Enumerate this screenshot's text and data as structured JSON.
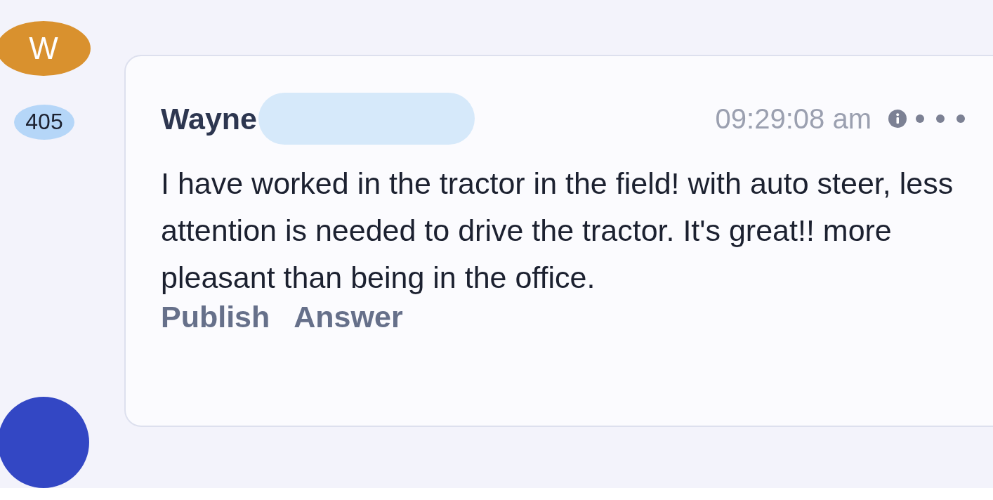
{
  "avatar": {
    "initial": "W",
    "color": "#d9912e"
  },
  "count_badge": "405",
  "message": {
    "author": "Wayne",
    "time": "09:29:08 am",
    "text": "I have worked in the tractor in the field! with auto steer, less attention is needed to drive the tractor. It's great!! more pleasant than being in the office.",
    "actions": [
      "Publish",
      "Answer"
    ]
  },
  "next_avatar": {
    "color": "#3347c4"
  }
}
